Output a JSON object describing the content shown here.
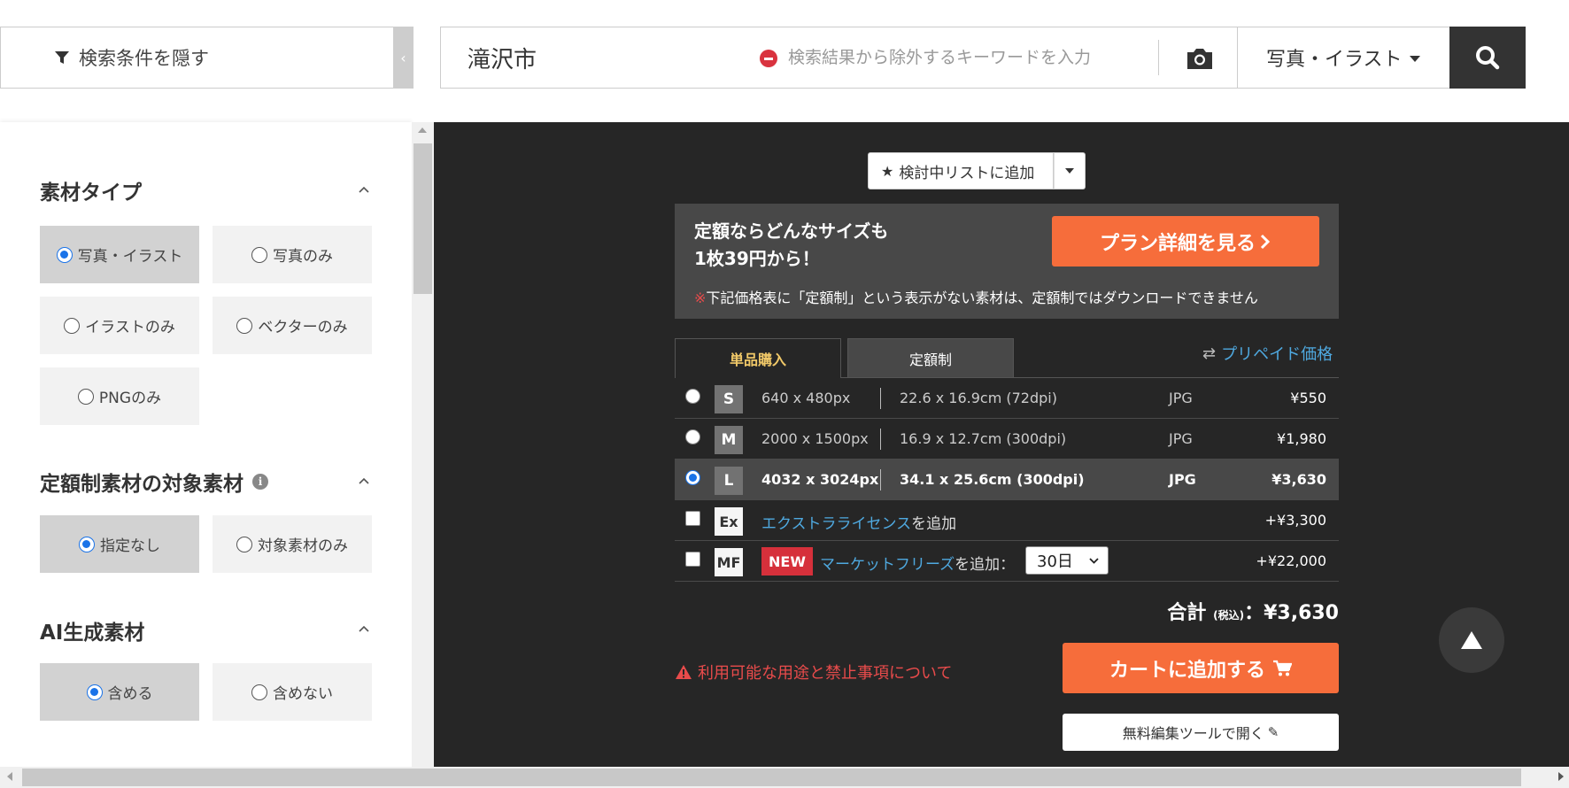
{
  "header": {
    "hide_filter_label": "検索条件を隠す",
    "search_value": "滝沢市",
    "exclude_placeholder": "検索結果から除外するキーワードを入力",
    "type_select": "写真・イラスト"
  },
  "sidebar": {
    "material_type": {
      "title": "素材タイプ",
      "options": [
        "写真・イラスト",
        "写真のみ",
        "イラストのみ",
        "ベクターのみ",
        "PNGのみ"
      ],
      "selected": "写真・イラスト"
    },
    "subscription_target": {
      "title": "定額制素材の対象素材",
      "options": [
        "指定なし",
        "対象素材のみ"
      ],
      "selected": "指定なし"
    },
    "ai_generated": {
      "title": "AI生成素材",
      "options": [
        "含める",
        "含めない"
      ],
      "selected": "含める"
    }
  },
  "main": {
    "wishlist_label": "検討中リストに追加",
    "plan": {
      "line1": "定額ならどんなサイズも",
      "line2": "1枚39円から！",
      "button": "プラン詳細を見る",
      "note_mark": "※",
      "note": "下記価格表に「定額制」という表示がない素材は、定額制ではダウンロードできません"
    },
    "tabs": [
      {
        "label": "単品購入",
        "active": true
      },
      {
        "label": "定額制",
        "active": false
      }
    ],
    "prepaid_label": "プリペイド価格",
    "sizes": [
      {
        "code": "S",
        "px": "640 x 480px",
        "cm": "22.6 x 16.9cm (72dpi)",
        "format": "JPG",
        "price": "¥550",
        "selected": false
      },
      {
        "code": "M",
        "px": "2000 x 1500px",
        "cm": "16.9 x 12.7cm (300dpi)",
        "format": "JPG",
        "price": "¥1,980",
        "selected": false
      },
      {
        "code": "L",
        "px": "4032 x 3024px",
        "cm": "34.1 x 25.6cm (300dpi)",
        "format": "JPG",
        "price": "¥3,630",
        "selected": true
      }
    ],
    "extra_license": {
      "code": "Ex",
      "link": "エクストラライセンス",
      "suffix": "を追加",
      "price": "+¥3,300"
    },
    "market_freeze": {
      "code": "MF",
      "new_badge": "NEW",
      "link": "マーケットフリーズ",
      "suffix": "を追加：",
      "duration": "30日",
      "price": "+¥22,000"
    },
    "total": {
      "label": "合計",
      "tax": "(税込)",
      "sep": "：",
      "value": "¥3,630"
    },
    "usage_link": "利用可能な用途と禁止事項について",
    "cart_button": "カートに追加する",
    "edit_button": "無料編集ツールで開く"
  }
}
